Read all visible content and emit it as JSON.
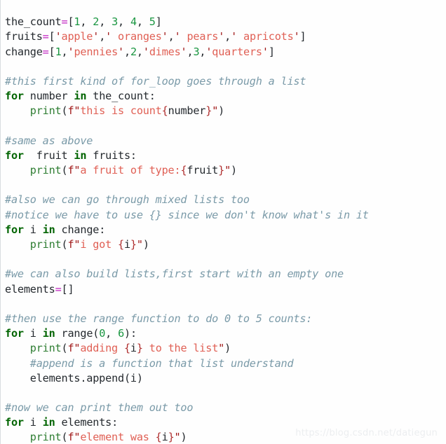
{
  "document": {
    "kind": "code-snippet",
    "language": "python",
    "background_color": "#fefefe",
    "colors": {
      "keyword": "#006400",
      "builtin": "#2e7d32",
      "number": "#1a9641",
      "operator": "#c020c0",
      "string": "#e06055",
      "quote": "#a01818",
      "brace": "#b03030",
      "identifier": "#24292e",
      "comment": "#7a9aa8",
      "watermark": "#eceef0"
    }
  },
  "watermark": {
    "text": "https://blog.csdn.net/datiegun"
  },
  "code": {
    "lines": [
      "the_count=[1, 2, 3, 4, 5]",
      "fruits=['apple',' oranges',' pears',' apricots']",
      "change=[1,'pennies',2,'dimes',3,'quarters']",
      "",
      "#this first kind of for_loop goes through a list",
      "for number in the_count:",
      "    print(f\"this is count{number}\")",
      "",
      "#same as above",
      "for  fruit in fruits:",
      "    print(f\"a fruit of type:{fruit}\")",
      "",
      "#also we can go through mixed lists too",
      "#notice we have to use {} since we don't know what's in it",
      "for i in change:",
      "    print(f\"i got {i}\")",
      "",
      "#we can also build lists,first start with an empty one",
      "elements=[]",
      "",
      "#then use the range function to do 0 to 5 counts:",
      "for i in range(0, 6):",
      "    print(f\"adding {i} to the list\")",
      "    #append is a function that list understand",
      "    elements.append(i)",
      "",
      "#now we can print them out too",
      "for i in elements:",
      "    print(f\"element was {i}\")"
    ],
    "tokens": {
      "keywords": [
        "for",
        "in"
      ],
      "builtins": [
        "print"
      ],
      "variables": [
        "the_count",
        "fruits",
        "change",
        "number",
        "fruit",
        "i",
        "elements",
        "range"
      ],
      "strings": [
        "'apple'",
        "' oranges'",
        "' pears'",
        "' apricots'",
        "'pennies'",
        "'dimes'",
        "'quarters'"
      ],
      "numbers": [
        "1",
        "2",
        "3",
        "4",
        "5",
        "0",
        "6"
      ],
      "comments": [
        "#this first kind of for_loop goes through a list",
        "#same as above",
        "#also we can go through mixed lists too",
        "#notice we have to use {} since we don't know what's in it",
        "#we can also build lists,first start with an empty one",
        "#then use the range function to do 0 to 5 counts:",
        "#append is a function that list understand",
        "#now we can print them out too"
      ]
    }
  }
}
